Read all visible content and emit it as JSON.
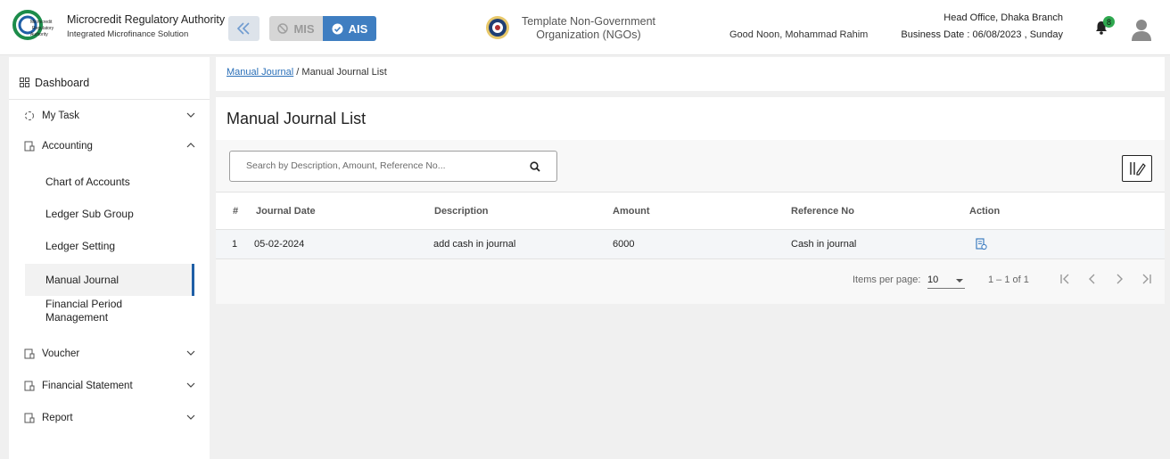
{
  "header": {
    "org_name": "Microcredit Regulatory Authority",
    "org_subtitle": "Integrated Microfinance Solution",
    "logo_text": [
      "Microcredit",
      "Regulatory",
      "Authority"
    ],
    "mis_label": "MIS",
    "ais_label": "AIS",
    "ngo_name_line1": "Template Non-Government",
    "ngo_name_line2": "Organization (NGOs)",
    "greeting": "Good Noon, Mohammad Rahim",
    "branch": "Head Office, Dhaka Branch",
    "business_date": "Business Date : 06/08/2023 , Sunday",
    "notification_count": "8"
  },
  "sidebar": {
    "dashboard": "Dashboard",
    "my_task": "My Task",
    "accounting": "Accounting",
    "sub_items": [
      "Chart of Accounts",
      "Ledger Sub Group",
      "Ledger Setting",
      "Manual Journal"
    ],
    "financial_period_line1": "Financial Period",
    "financial_period_line2": "Management",
    "voucher": "Voucher",
    "financial_statement": "Financial Statement",
    "report": "Report"
  },
  "breadcrumb": {
    "link": "Manual Journal",
    "separator": "/",
    "current": "Manual Journal List"
  },
  "page": {
    "title": "Manual Journal List",
    "search_placeholder": "Search by Description, Amount, Reference No...",
    "columns": [
      "#",
      "Journal Date",
      "Description",
      "Amount",
      "Reference No",
      "Action"
    ],
    "rows": [
      {
        "index": "1",
        "date": "05-02-2024",
        "description": "add cash in journal",
        "amount": "6000",
        "reference": "Cash in journal"
      }
    ],
    "items_per_page_label": "Items per page:",
    "items_per_page": "10",
    "range": "1 – 1 of 1"
  },
  "colors": {
    "accent": "#3f7ec1",
    "active_bar": "#1f5fa6",
    "badge": "#2fa84f",
    "link": "#2a6fb8"
  }
}
